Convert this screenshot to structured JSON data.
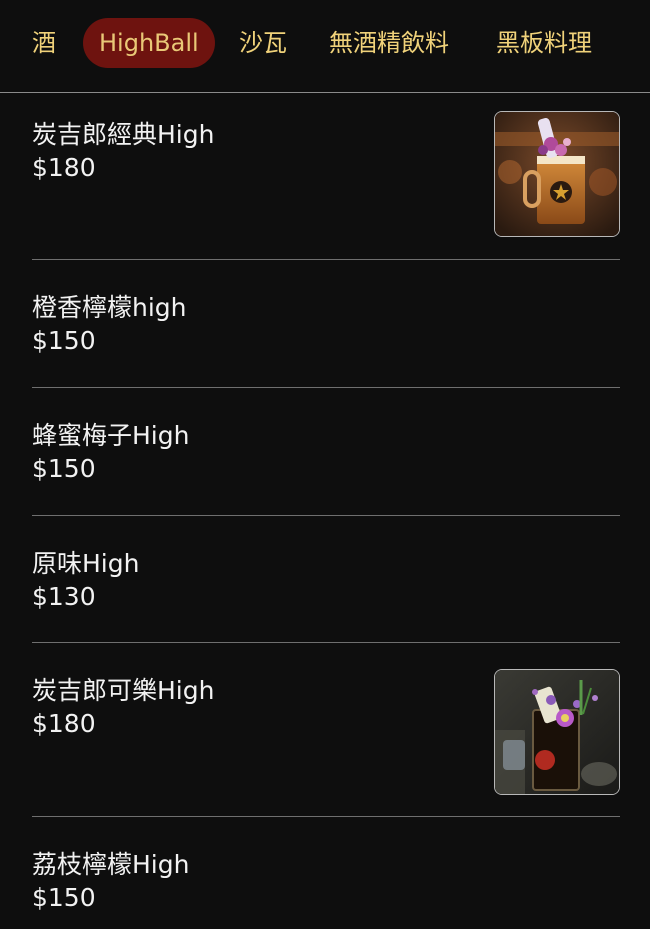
{
  "tabs": [
    {
      "label": "酒",
      "active": false
    },
    {
      "label": "HighBall",
      "active": true
    },
    {
      "label": "沙瓦",
      "active": false
    },
    {
      "label": "無酒精飲料",
      "active": false
    },
    {
      "label": "黑板料理",
      "active": false
    }
  ],
  "items": [
    {
      "name": "炭吉郎經典High",
      "price": "$180",
      "image": "beer-mug-with-flowers-photo"
    },
    {
      "name": "橙香檸檬high",
      "price": "$150"
    },
    {
      "name": "蜂蜜梅子High",
      "price": "$150"
    },
    {
      "name": "原味High",
      "price": "$130"
    },
    {
      "name": "炭吉郎可樂High",
      "price": "$180",
      "image": "highball-glass-with-flower-photo"
    },
    {
      "name": "荔枝檸檬High",
      "price": "$150"
    }
  ],
  "colors": {
    "background": "#0e0e0e",
    "tab_text": "#f0d27a",
    "active_tab_bg": "#6e130f",
    "item_text": "#f2f2f2",
    "divider": "#6f6f6f"
  }
}
